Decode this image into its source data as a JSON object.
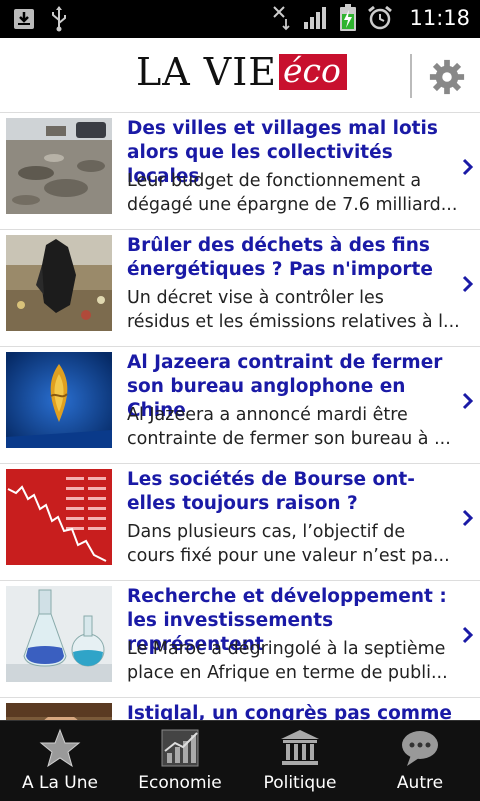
{
  "status_bar": {
    "time": "11:18",
    "icons": [
      "download-icon",
      "usb-icon",
      "data-arrows-icon",
      "signal-icon",
      "battery-charging-icon",
      "alarm-icon"
    ]
  },
  "header": {
    "logo_main": "LA VIE",
    "logo_accent": "éco",
    "logo_accent_color": "#c8102e",
    "settings_icon": "gear-icon"
  },
  "articles": [
    {
      "title": "Des villes et villages mal lotis alors que les collectivités locales",
      "summary_line1": "Leur budget de fonctionnement a",
      "summary_line2": "dégagé une épargne de 7.6 milliard..."
    },
    {
      "title": "Brûler des déchets à des fins énergétiques ? Pas n'importe",
      "summary_line1": "Un décret vise à contrôler les",
      "summary_line2": "résidus et les émissions relatives à l..."
    },
    {
      "title": "Al Jazeera contraint de fermer son bureau anglophone en Chine",
      "summary_line1": "Al Jazeera a annoncé mardi être",
      "summary_line2": "contrainte de fermer son bureau à ..."
    },
    {
      "title": "Les sociétés de Bourse ont-elles toujours raison ?",
      "summary_line1": "Dans plusieurs cas, l’objectif de",
      "summary_line2": "cours fixé pour une valeur n’est pa..."
    },
    {
      "title": "Recherche et développement : les investissements représentent",
      "summary_line1": "Le Maroc a dégringolé à la septième",
      "summary_line2": "place en Afrique en terme de publi..."
    },
    {
      "title": "Istiqlal, un congrès pas comme",
      "summary_line1": "",
      "summary_line2": ""
    }
  ],
  "tabs": [
    {
      "label": "A La Une",
      "icon": "star-icon"
    },
    {
      "label": "Economie",
      "icon": "chart-icon"
    },
    {
      "label": "Politique",
      "icon": "building-icon"
    },
    {
      "label": "Autre",
      "icon": "speech-bubble-icon"
    }
  ],
  "colors": {
    "title_link": "#1a1aa6",
    "background": "#ffffff",
    "tab_bar": "#111111"
  }
}
